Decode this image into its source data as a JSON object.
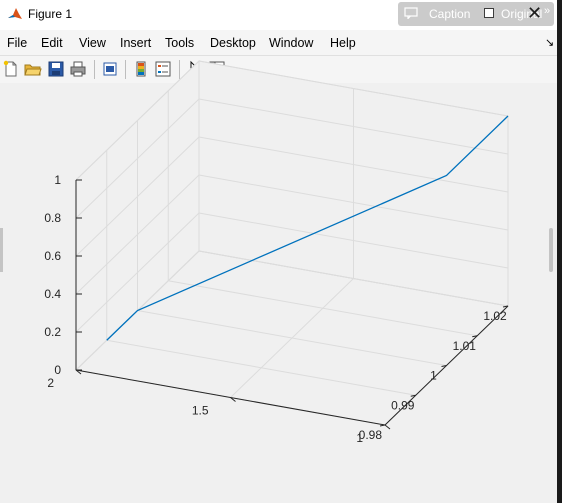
{
  "window": {
    "title": "Figure 1"
  },
  "overlay": {
    "caption_label": "Caption",
    "original_label": "Original"
  },
  "menu": [
    "File",
    "Edit",
    "View",
    "Insert",
    "Tools",
    "Desktop",
    "Window",
    "Help"
  ],
  "toolbar_icons": [
    "new-figure-icon",
    "open-file-icon",
    "save-icon",
    "print-icon",
    "print-preview-icon",
    "colorbar-icon",
    "legend-icon",
    "edit-plot-icon",
    "property-inspector-icon"
  ],
  "chart_data": {
    "type": "line",
    "projection": "3d",
    "series": [
      {
        "x": [
          1.02,
          1.0,
          1.0,
          0.99
        ],
        "y": [
          1.0,
          1.0,
          2.0,
          2.0
        ],
        "z": [
          1.0,
          1.0,
          0.0,
          0.0
        ]
      }
    ],
    "xlim": [
      0.98,
      1.02
    ],
    "ylim": [
      1,
      2
    ],
    "zlim": [
      0,
      1
    ],
    "xticks": [
      "0.98",
      "0.99",
      "1",
      "1.01",
      "1.02"
    ],
    "yticks": [
      "1",
      "1.5",
      "2"
    ],
    "zticks": [
      "0",
      "0.2",
      "0.4",
      "0.6",
      "0.8",
      "1"
    ],
    "grid": true,
    "line_color": "#0072bd"
  }
}
